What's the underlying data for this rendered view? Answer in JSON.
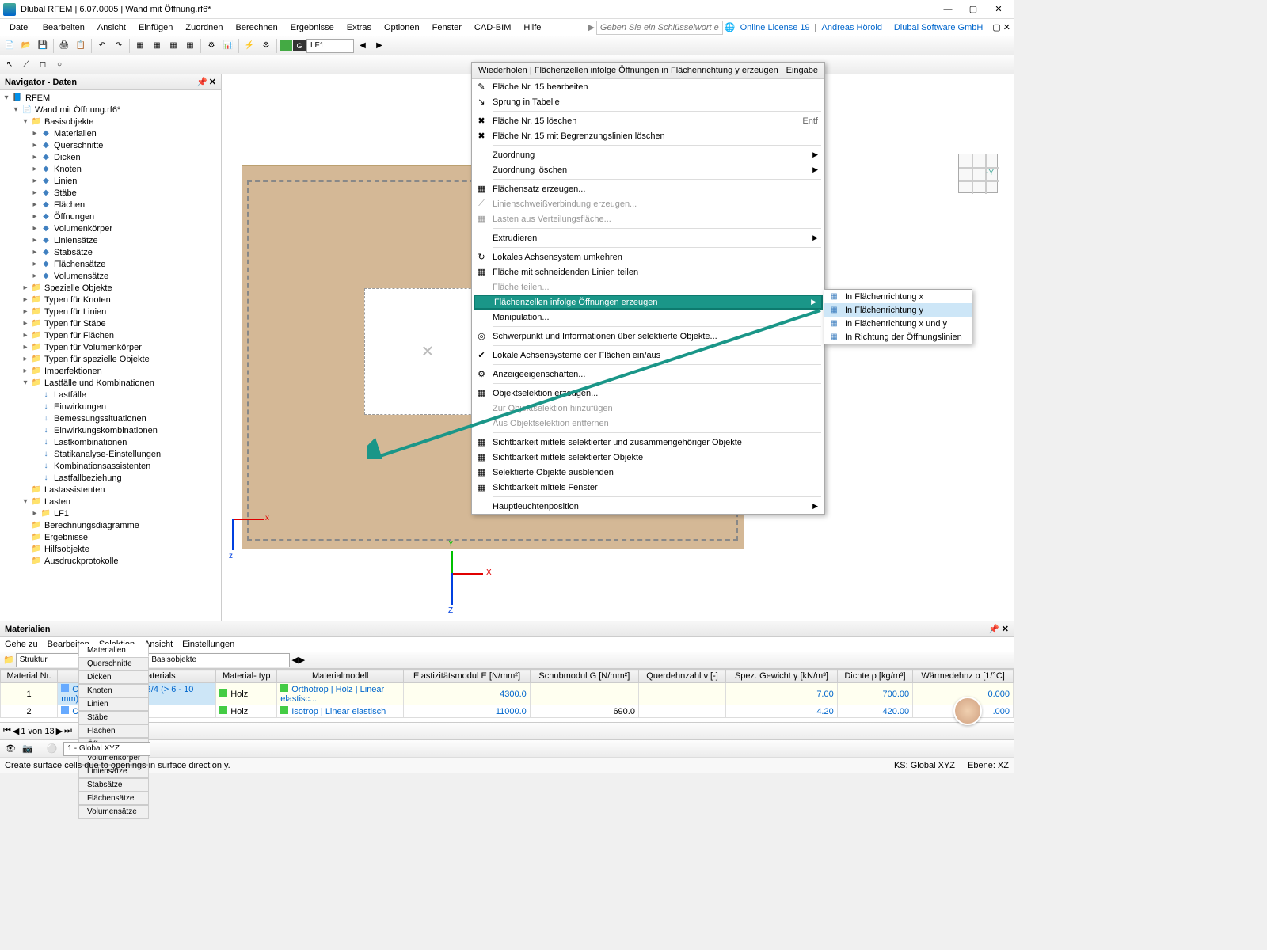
{
  "title": "Dlubal RFEM | 6.07.0005 | Wand mit Öffnung.rf6*",
  "menubar": [
    "Datei",
    "Bearbeiten",
    "Ansicht",
    "Einfügen",
    "Zuordnen",
    "Berechnen",
    "Ergebnisse",
    "Extras",
    "Optionen",
    "Fenster",
    "CAD-BIM",
    "Hilfe"
  ],
  "search_ph": "Geben Sie ein Schlüsselwort ein (Alt...",
  "license": "Online License 19",
  "user": "Andreas Hörold",
  "company": "Dlubal Software GmbH",
  "lf": "LF1",
  "nav_title": "Navigator - Daten",
  "tree": {
    "root": "RFEM",
    "model": "Wand mit Öffnung.rf6*",
    "basis": "Basisobjekte",
    "basis_children": [
      "Materialien",
      "Querschnitte",
      "Dicken",
      "Knoten",
      "Linien",
      "Stäbe",
      "Flächen",
      "Öffnungen",
      "Volumenkörper",
      "Liniensätze",
      "Stabsätze",
      "Flächensätze",
      "Volumensätze"
    ],
    "groups": [
      "Spezielle Objekte",
      "Typen für Knoten",
      "Typen für Linien",
      "Typen für Stäbe",
      "Typen für Flächen",
      "Typen für Volumenkörper",
      "Typen für spezielle Objekte",
      "Imperfektionen"
    ],
    "lc_grp": "Lastfälle und Kombinationen",
    "lc_children": [
      "Lastfälle",
      "Einwirkungen",
      "Bemessungssituationen",
      "Einwirkungskombinationen",
      "Lastkombinationen",
      "Statikanalyse-Einstellungen",
      "Kombinationsassistenten",
      "Lastfallbeziehung"
    ],
    "nodes2": [
      "Lastassistenten"
    ],
    "lasten": "Lasten",
    "lf1": "LF1",
    "rest": [
      "Berechnungsdiagramme",
      "Ergebnisse",
      "Hilfsobjekte",
      "Ausdruckprotokolle"
    ]
  },
  "ctx": {
    "header": "Wiederholen  |  Flächenzellen infolge Öffnungen in Flächenrichtung y erzeugen",
    "header_r": "Eingabe",
    "items": [
      {
        "t": "Fläche Nr. 15 bearbeiten",
        "i": "✎"
      },
      {
        "t": "Sprung in Tabelle",
        "i": "↘"
      },
      {
        "sep": 1
      },
      {
        "t": "Fläche Nr. 15 löschen",
        "i": "✖",
        "sc": "Entf"
      },
      {
        "t": "Fläche Nr. 15 mit Begrenzungslinien löschen",
        "i": "✖"
      },
      {
        "sep": 1
      },
      {
        "t": "Zuordnung",
        "sub": 1
      },
      {
        "t": "Zuordnung löschen",
        "sub": 1
      },
      {
        "sep": 1
      },
      {
        "t": "Flächensatz erzeugen...",
        "i": "▦"
      },
      {
        "t": "Linienschweißverbindung erzeugen...",
        "dis": 1,
        "i": "⟋"
      },
      {
        "t": "Lasten aus Verteilungsfläche...",
        "dis": 1,
        "i": "▦"
      },
      {
        "sep": 1
      },
      {
        "t": "Extrudieren",
        "sub": 1
      },
      {
        "sep": 1
      },
      {
        "t": "Lokales Achsensystem umkehren",
        "i": "↻"
      },
      {
        "t": "Fläche mit schneidenden Linien teilen",
        "i": "▦"
      },
      {
        "t": "Fläche teilen...",
        "dis": 1
      },
      {
        "t": "Flächenzellen infolge Öffnungen erzeugen",
        "hl": 1,
        "sub": 1
      },
      {
        "t": "Manipulation..."
      },
      {
        "sep": 1
      },
      {
        "t": "Schwerpunkt und Informationen über selektierte Objekte...",
        "i": "◎"
      },
      {
        "sep": 1
      },
      {
        "t": "Lokale Achsensysteme der Flächen ein/aus",
        "chk": 1
      },
      {
        "sep": 1
      },
      {
        "t": "Anzeigeeigenschaften...",
        "i": "⚙"
      },
      {
        "sep": 1
      },
      {
        "t": "Objektselektion erzeugen...",
        "i": "▦"
      },
      {
        "t": "Zur Objektselektion hinzufügen",
        "dis": 1
      },
      {
        "t": "Aus Objektselektion entfernen",
        "dis": 1
      },
      {
        "sep": 1
      },
      {
        "t": "Sichtbarkeit mittels selektierter und zusammengehöriger Objekte",
        "i": "▦"
      },
      {
        "t": "Sichtbarkeit mittels selektierter Objekte",
        "i": "▦"
      },
      {
        "t": "Selektierte Objekte ausblenden",
        "i": "▦"
      },
      {
        "t": "Sichtbarkeit mittels Fenster",
        "i": "▦"
      },
      {
        "sep": 1
      },
      {
        "t": "Hauptleuchtenposition",
        "sub": 1
      }
    ]
  },
  "submenu": [
    {
      "t": "In Flächenrichtung x"
    },
    {
      "t": "In Flächenrichtung y",
      "hl": 1
    },
    {
      "t": "In Flächenrichtung x und y"
    },
    {
      "t": "In Richtung der Öffnungslinien"
    }
  ],
  "materials": {
    "title": "Materialien",
    "menu": [
      "Gehe zu",
      "Bearbeiten",
      "Selektion",
      "Ansicht",
      "Einstellungen"
    ],
    "sel1": "Struktur",
    "sel2": "Basisobjekte",
    "headers": [
      "Material\nNr.",
      "Name des Materials",
      "Material-\ntyp",
      "Materialmodell",
      "Elastizitätsmodul\nE [N/mm²]",
      "Schubmodul\nG [N/mm²]",
      "Querdehnzahl\nν [-]",
      "Spez. Gewicht\nγ [kN/m³]",
      "Dichte\nρ [kg/m³]",
      "Wärmedehnz\nα [1/°C]"
    ],
    "rows": [
      {
        "nr": "1",
        "name": "OSB (EN 300), OSB/4 (> 6 - 10 mm)",
        "typ": "Holz",
        "modell": "Orthotrop | Holz | Linear elastisc...",
        "e": "4300.0",
        "g": "",
        "v": "",
        "gamma": "7.00",
        "rho": "700.00",
        "a": "0.000"
      },
      {
        "nr": "2",
        "name": "C24",
        "typ": "Holz",
        "modell": "Isotrop | Linear elastisch",
        "e": "11000.0",
        "g": "690.0",
        "v": "",
        "gamma": "4.20",
        "rho": "420.00",
        "a": ".000"
      }
    ]
  },
  "tabs": [
    "Materialien",
    "Querschnitte",
    "Dicken",
    "Knoten",
    "Linien",
    "Stäbe",
    "Flächen",
    "Öffnungen",
    "Volumenkörper",
    "Liniensätze",
    "Stabsätze",
    "Flächensätze",
    "Volumensätze"
  ],
  "pager": "1 von 13",
  "status": {
    "coord": "1 - Global XYZ",
    "msg": "Create surface cells due to openings in surface direction y.",
    "ks": "KS: Global XYZ",
    "ebene": "Ebene: XZ"
  },
  "cube_label": "-Y"
}
